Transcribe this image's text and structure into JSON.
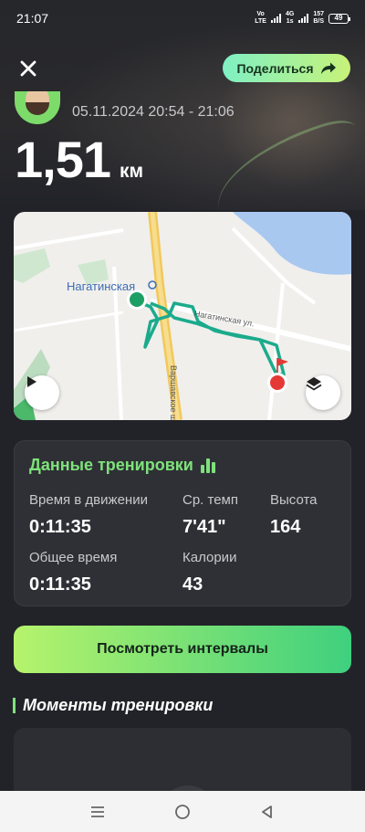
{
  "status_bar": {
    "time": "21:07",
    "net1_top": "Vo",
    "net1_bottom": "LTE",
    "net2_top": "4G",
    "net2_bottom": "1s",
    "speed_top": "157",
    "speed_bottom": "B/S",
    "battery": "49"
  },
  "header": {
    "close_icon": "close-icon",
    "share_label": "Поделиться",
    "share_icon": "share-arrow-icon"
  },
  "workout": {
    "datetime": "05.11.2024 20:54 - 21:06",
    "distance_value": "1,51",
    "distance_unit": "км"
  },
  "map": {
    "station_label": "Нагатинская",
    "street_label": "Нагатинская ул.",
    "road_label": "Варшавское ш.",
    "play_icon": "play-icon",
    "layers_icon": "layers-icon",
    "route_color": "#1bab8c"
  },
  "stats": {
    "title": "Данные тренировки",
    "title_icon": "bar-chart-icon",
    "moving_time_label": "Время в движении",
    "moving_time_value": "0:11:35",
    "pace_label": "Ср. темп",
    "pace_value": "7'41\"",
    "elevation_label": "Высота",
    "elevation_value": "164",
    "total_time_label": "Общее время",
    "total_time_value": "0:11:35",
    "calories_label": "Калории",
    "calories_value": "43"
  },
  "intervals_button": "Посмотреть интервалы",
  "moments": {
    "title": "Моменты тренировки"
  },
  "nav_bar": {
    "menu_icon": "menu-icon",
    "home_icon": "home-circle-icon",
    "back_icon": "back-triangle-icon"
  },
  "colors": {
    "background": "#222329",
    "accent_green": "#7ee27a",
    "card": "#2f3036"
  }
}
